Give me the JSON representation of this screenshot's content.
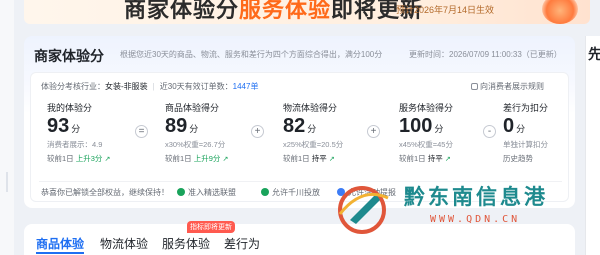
{
  "banner": {
    "title_part1": "商家体验分",
    "title_part2": "服务体验",
    "title_part3": "即将更新",
    "note": "预计2026年7月14日生效"
  },
  "side": {
    "right_label": "先"
  },
  "card": {
    "title": "商家体验分",
    "description": "根据您近30天的商品、物流、服务和差行为四个方面综合得出，满分100分",
    "update_label": "更新时间：",
    "update_time": "2026/07/09 11:00:33（已更新）"
  },
  "meta": {
    "industry_label": "体验分考核行业：",
    "industry": "女装-非服装",
    "orders_label": "近30天有效订单数：",
    "orders": "1447单",
    "rule_link": "向消费者展示规则"
  },
  "metrics": {
    "overall": {
      "label": "我的体验分",
      "value": "93",
      "unit": "分",
      "sub": "消费者展示：4.9",
      "cmp_prefix": "较前1日",
      "cmp_value": "上升3分"
    },
    "product": {
      "label": "商品体验得分",
      "value": "89",
      "unit": "分",
      "sub": "x30%权重=26.7分",
      "cmp_prefix": "较前1日",
      "cmp_value": "上升9分"
    },
    "logistics": {
      "label": "物流体验得分",
      "value": "82",
      "unit": "分",
      "sub": "x25%权重=20.5分",
      "cmp_prefix": "较前1日",
      "cmp_value": "持平"
    },
    "service": {
      "label": "服务体验得分",
      "value": "100",
      "unit": "分",
      "sub": "x45%权重=45分",
      "cmp_prefix": "较前1日",
      "cmp_value": "持平"
    },
    "penalty": {
      "label": "差行为扣分",
      "value": "0",
      "unit": "分",
      "sub": "单独计算扣分",
      "cmp_prefix": "历史趋势",
      "cmp_value": ""
    }
  },
  "operators": {
    "equals": "=",
    "plus": "+",
    "minus": "-"
  },
  "benefits": {
    "text": "恭喜你已解锁全部权益，继续保持！",
    "items": [
      "准入精选联盟",
      "允许千川投放",
      "允许活动提报"
    ]
  },
  "tabs": {
    "items": [
      "商品体验",
      "物流体验",
      "服务体验",
      "差行为"
    ],
    "badge": "指标即将更新"
  },
  "watermark": {
    "text": "黔东南信息港",
    "url": "WWW.QDN.CN"
  },
  "colors": {
    "accent": "#1f6ff2",
    "orange": "#ff6a1a",
    "up_green": "#19a35b",
    "watermark_teal": "#1e8a8e"
  }
}
